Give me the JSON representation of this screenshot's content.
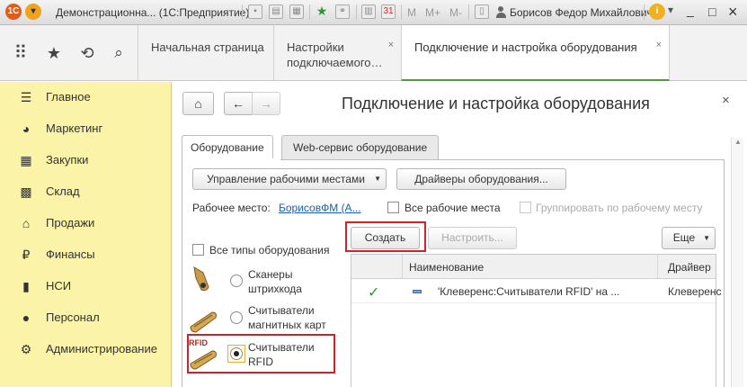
{
  "titlebar": {
    "title": "Демонстрационна... (1С:Предприятие)",
    "user": "Борисов Федор Михайлович",
    "m_buttons": [
      "M",
      "M+",
      "M-"
    ],
    "controls": {
      "info": "i",
      "minimize": "_",
      "maximize": "□",
      "close": "×"
    }
  },
  "topnav": {
    "tabs": [
      {
        "label": "Начальная страница"
      },
      {
        "label": "Настройки подключаемого…",
        "close": "×"
      },
      {
        "label": "Подключение и настройка оборудования",
        "close": "×"
      }
    ]
  },
  "sidebar": {
    "items": [
      {
        "label": "Главное",
        "icon": "menu-icon"
      },
      {
        "label": "Маркетинг",
        "icon": "pie-chart-icon"
      },
      {
        "label": "Закупки",
        "icon": "cart-icon"
      },
      {
        "label": "Склад",
        "icon": "warehouse-grid-icon"
      },
      {
        "label": "Продажи",
        "icon": "basket-icon"
      },
      {
        "label": "Финансы",
        "icon": "ruble-coin-icon"
      },
      {
        "label": "НСИ",
        "icon": "book-icon"
      },
      {
        "label": "Персонал",
        "icon": "person-icon"
      },
      {
        "label": "Администрирование",
        "icon": "gear-icon"
      }
    ]
  },
  "form": {
    "title": "Подключение и настройка оборудования",
    "close": "×",
    "tabs": [
      "Оборудование",
      "Web-сервис оборудование"
    ],
    "manage_workplaces": "Управление рабочими местами",
    "drivers_button": "Драйверы оборудования...",
    "workplace_label": "Рабочее место:",
    "workplace_value": "БорисовФМ (А...",
    "all_workplaces": "Все рабочие места",
    "group_by_workplace": "Группировать по рабочему месту",
    "all_types": "Все типы оборудования",
    "create_button": "Создать",
    "configure_button": "Настроить...",
    "more_button": "Еще",
    "device_types": [
      {
        "label": "Сканеры штрихкода",
        "selected": false
      },
      {
        "label": "Считыватели магнитных карт",
        "selected": false
      },
      {
        "label": "Считыватели RFID",
        "selected": true,
        "badge": "RFID"
      }
    ],
    "table": {
      "columns": [
        "Наименование",
        "Драйвер"
      ],
      "rows": [
        {
          "check": "✓",
          "name": "'Клеверенс:Считыватели RFID' на ...",
          "driver": "Клеверенс"
        }
      ]
    }
  },
  "colors": {
    "accent_green": "#4d9e3a",
    "sidebar_bg": "#fbf3a8",
    "highlight_red": "#d4202a",
    "link": "#1a5fa8"
  }
}
